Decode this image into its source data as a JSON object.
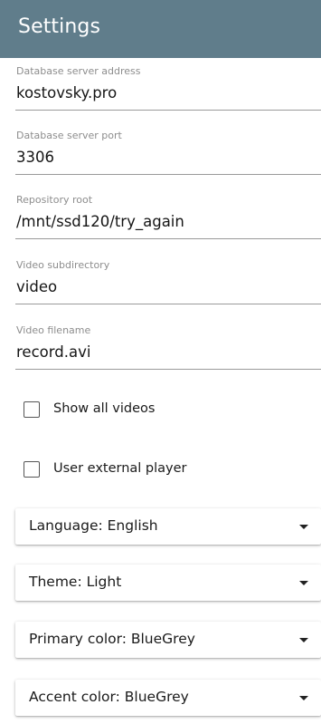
{
  "header": {
    "title": "Settings"
  },
  "fields": [
    {
      "label": "Database server address",
      "value": "kostovsky.pro"
    },
    {
      "label": "Database server port",
      "value": "3306"
    },
    {
      "label": "Repository root",
      "value": "/mnt/ssd120/try_again"
    },
    {
      "label": "Video subdirectory",
      "value": "video"
    },
    {
      "label": "Video filename",
      "value": "record.avi"
    }
  ],
  "checkboxes": [
    {
      "label": "Show all videos",
      "checked": false
    },
    {
      "label": "User external player",
      "checked": false
    }
  ],
  "selects": [
    {
      "text": "Language: English"
    },
    {
      "text": "Theme: Light"
    },
    {
      "text": "Primary color: BlueGrey"
    },
    {
      "text": "Accent color: BlueGrey"
    }
  ],
  "icons": {
    "dropdown": "caret-down-icon"
  },
  "colors": {
    "header_bg": "#607d8b",
    "header_text": "#ffffff",
    "label_text": "#8d8d8d",
    "underline": "#9a9a9a"
  }
}
